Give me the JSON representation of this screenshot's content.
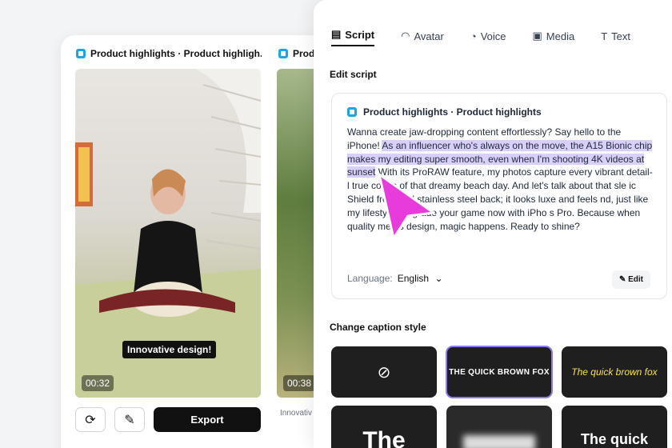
{
  "left_card": {
    "video1": {
      "title": "Product highlights · Product highligh...",
      "time": "00:32",
      "caption": "Innovative design!"
    },
    "video2": {
      "title": "Prod",
      "time": "00:38",
      "sub_label": "Innovativ"
    },
    "export_label": "Export",
    "icons": [
      "refresh-icon",
      "pencil-icon"
    ]
  },
  "panel": {
    "tabs": [
      {
        "label": "Script",
        "icon": "script-icon",
        "active": true
      },
      {
        "label": "Avatar",
        "icon": "avatar-icon",
        "active": false
      },
      {
        "label": "Voice",
        "icon": "voice-icon",
        "active": false
      },
      {
        "label": "Media",
        "icon": "media-icon",
        "active": false
      },
      {
        "label": "Text",
        "icon": "text-icon",
        "active": false
      }
    ],
    "edit_script_heading": "Edit script",
    "script_title": "Product highlights · Product highlights",
    "script_pre": "Wanna create jaw-dropping content effortlessly? Say hello to the iPhone! ",
    "script_highlight": "As an influencer who's always on the move, the A15 Bionic chip makes my editing super smooth, even when I'm shooting 4K videos at sunset",
    "script_post": " With its ProRAW feature, my photos capture every vibrant detail-l     true colors of that dreamy beach day. And let's talk about that sle       ic Shield front and stainless steel back; it looks luxe and feels       nd, just like my lifestyle. Upgrade your game now with iPho      s Pro. Because when quality meets design, magic happens. Ready to shine?",
    "language_label": "Language:",
    "language_value": "English",
    "edit_label": "Edit",
    "caption_style_heading": "Change caption style",
    "caption_styles": [
      {
        "label": "",
        "icon": "none-icon"
      },
      {
        "label": "THE QUICK BROWN FOX"
      },
      {
        "label": "The quick brown fox"
      },
      {
        "label": "The"
      },
      {
        "label": ""
      },
      {
        "label": "The quick"
      }
    ],
    "accent_color": "#8b7cf6",
    "highlight_color": "#d9cffb",
    "pointer_color": "#e83bdc"
  }
}
